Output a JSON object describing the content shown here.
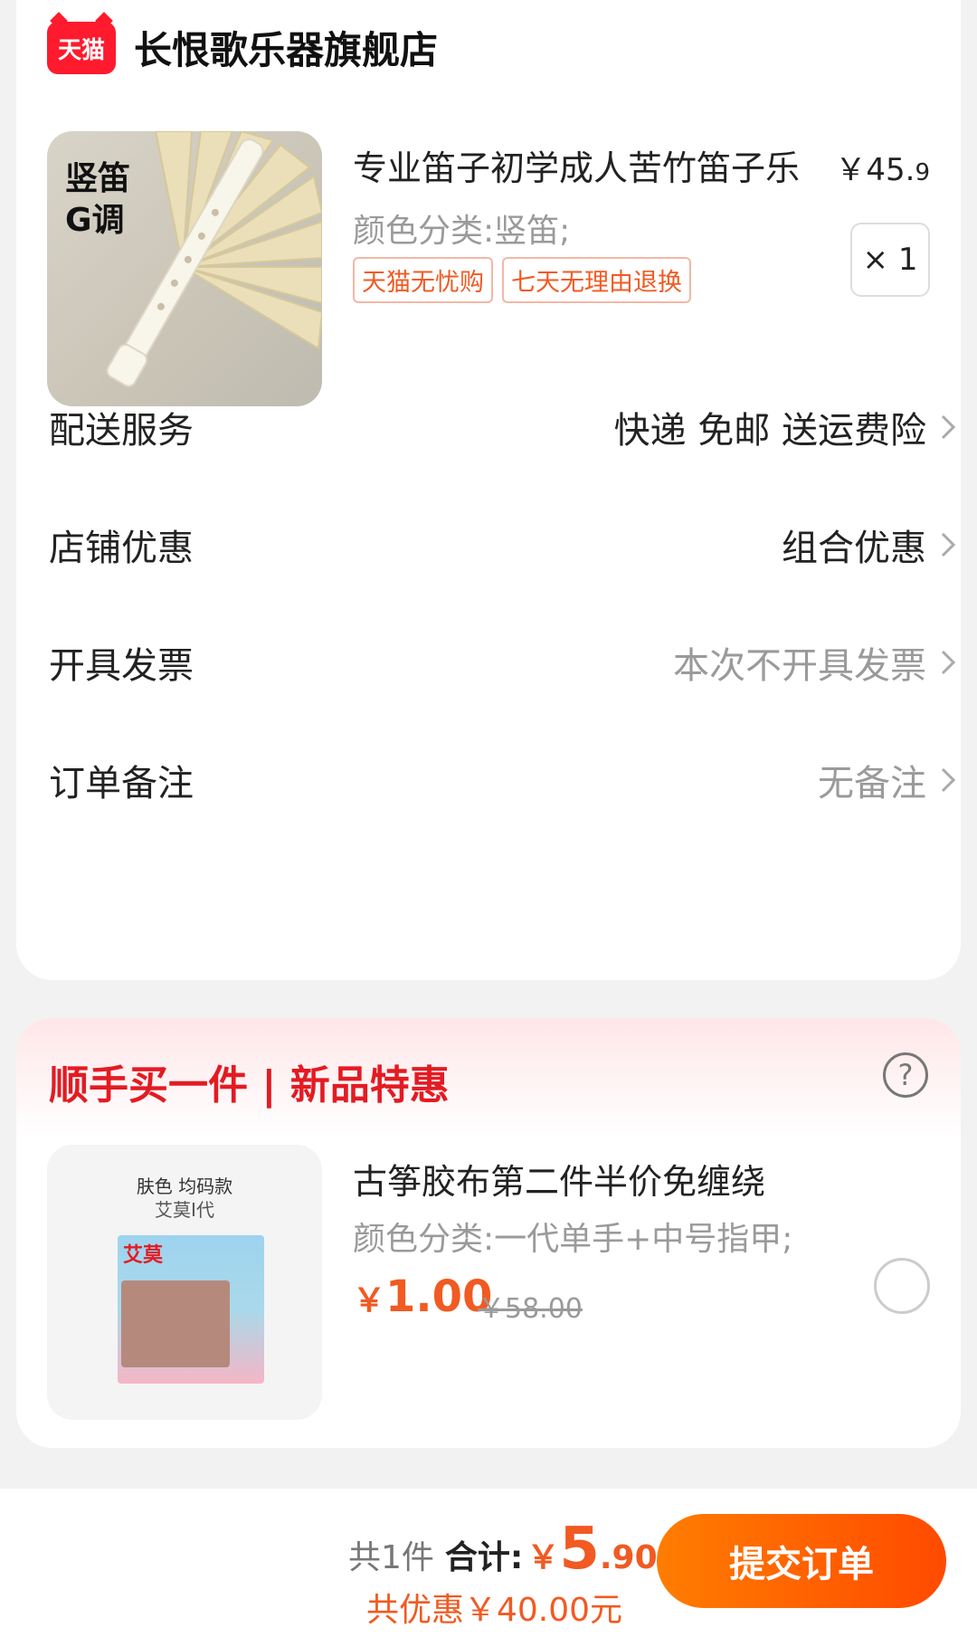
{
  "store": {
    "logo_text": "天猫",
    "name": "长恨歌乐器旗舰店"
  },
  "product": {
    "image_text_line1": "竖笛",
    "image_text_line2": "G调",
    "title": "专业笛子初学成人苦竹笛子乐",
    "price_main": "￥45.",
    "price_decimal": "9",
    "variant": "颜色分类:竖笛;",
    "tags": [
      "天猫无忧购",
      "七天无理由退换"
    ],
    "quantity": "× 1"
  },
  "rows": [
    {
      "label": "配送服务",
      "value": "快递 免邮 送运费险"
    },
    {
      "label": "店铺优惠",
      "value": "组合优惠"
    },
    {
      "label": "开具发票",
      "value": "本次不开具发票"
    },
    {
      "label": "订单备注",
      "value": "无备注"
    }
  ],
  "promo": {
    "title": "顺手买一件 | 新品特惠",
    "help_symbol": "?",
    "image_line1": "肤色 均码款",
    "image_line2": "艾莫I代",
    "image_brand": "艾莫",
    "item_title": "古筝胶布第二件半价免缠绕",
    "item_variant": "颜色分类:一代单手+中号指甲;",
    "price_yen": "￥",
    "price": "1.00",
    "original_price": "￥58.00",
    "selected": false
  },
  "footer": {
    "count": "共1件",
    "total_label": "合计:",
    "total_yen": "￥",
    "total_int": "5",
    "total_dec": ".90",
    "discount": "共优惠￥40.00元",
    "submit_label": "提交订单"
  },
  "colors": {
    "accent": "#f15a22",
    "tmall_red": "#ff1a2d",
    "promo_red": "#e31b23"
  }
}
